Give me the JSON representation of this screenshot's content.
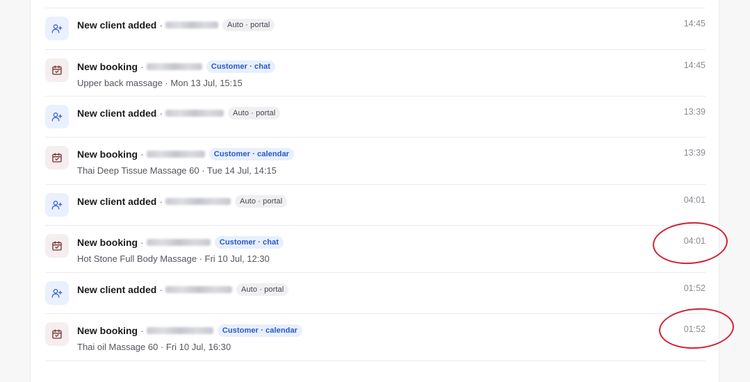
{
  "events": [
    {
      "kind": "client",
      "title": "New client added",
      "separator": "·",
      "badge": "Auto · portal",
      "time": "14:45"
    },
    {
      "kind": "booking",
      "title": "New booking",
      "separator": "·",
      "badge": "Customer · chat",
      "detail": "Upper back massage · Mon 13 Jul, 15:15",
      "time": "14:45"
    },
    {
      "kind": "client",
      "title": "New client added",
      "separator": "·",
      "badge": "Auto · portal",
      "time": "13:39"
    },
    {
      "kind": "booking",
      "title": "New booking",
      "separator": "·",
      "badge": "Customer · calendar",
      "detail": "Thai Deep Tissue Massage 60 · Tue 14 Jul, 14:15",
      "time": "13:39"
    },
    {
      "kind": "client",
      "title": "New client added",
      "separator": "·",
      "badge": "Auto · portal",
      "time": "04:01"
    },
    {
      "kind": "booking",
      "title": "New booking",
      "separator": "·",
      "badge": "Customer · chat",
      "detail": "Hot Stone Full Body Massage · Fri 10 Jul, 12:30",
      "time": "04:01"
    },
    {
      "kind": "client",
      "title": "New client added",
      "separator": "·",
      "badge": "Auto · portal",
      "time": "01:52"
    },
    {
      "kind": "booking",
      "title": "New booking",
      "separator": "·",
      "badge": "Customer · calendar",
      "detail": "Thai oil Massage 60 · Fri 10 Jul, 16:30",
      "time": "01:52"
    }
  ],
  "colors": {
    "client_icon_bg": "#eaf0fd",
    "booking_icon_bg": "#f5eeee",
    "customer_badge_text": "#2758c9",
    "annotation": "#d4202f"
  },
  "icons": {
    "client": "user-plus-icon",
    "booking": "calendar-check-icon"
  }
}
